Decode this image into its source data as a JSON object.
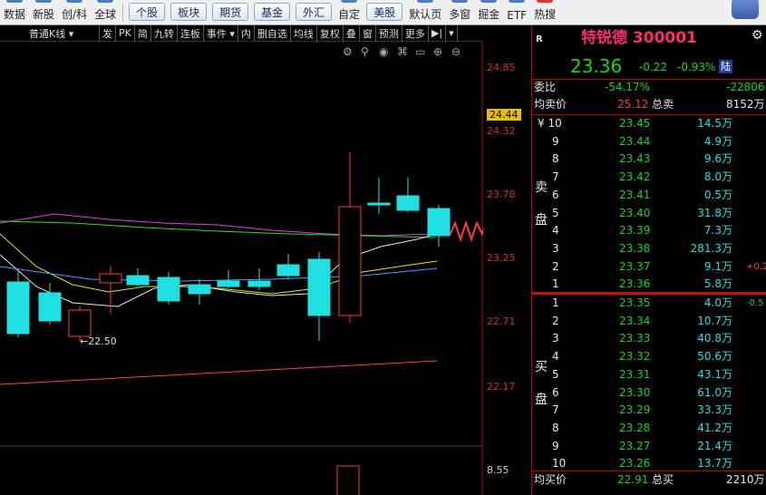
{
  "toolbar": {
    "items_left": [
      "数据",
      "新股",
      "创/科",
      "全球"
    ],
    "buttons": [
      "个股",
      "板块",
      "期货",
      "基金",
      "外汇"
    ],
    "items_mid": [
      "自定"
    ],
    "button2": "美股",
    "items_right": [
      "默认页",
      "多窗",
      "掘金",
      "ETF",
      "热搜"
    ]
  },
  "chart_tools": [
    "普通K线 ▾",
    "发",
    "PK",
    "简",
    "九转",
    "连板",
    "事件 ▾",
    "内",
    "删自选",
    "均线",
    "复权",
    "叠",
    "窗",
    "预测",
    "更多",
    "▶|",
    "▾"
  ],
  "price_axis": [
    "24.85",
    "24.44",
    "24.32",
    "23.78",
    "23.25",
    "22.71",
    "22.17",
    "8.55"
  ],
  "low_label": "22.50",
  "quote": {
    "badge": "R",
    "name_code": "特锐德 300001",
    "price": "23.36",
    "change": "-0.22",
    "change_pct": "-0.93%",
    "tag": "陆",
    "weibi_label": "委比",
    "weibi_value": "-54.17%",
    "weicha_value": "-22806",
    "avg_sell_label": "均卖价",
    "avg_sell_value": "25.12",
    "total_sell_label": "总卖",
    "total_sell_value": "8152万",
    "sell_side_label_1": "卖",
    "sell_side_label_2": "盘",
    "buy_side_label_1": "买",
    "buy_side_label_2": "盘",
    "sell_levels": [
      {
        "lv": "¥ 10",
        "price": "23.45",
        "vol": "14.5万"
      },
      {
        "lv": "9",
        "price": "23.44",
        "vol": "4.9万"
      },
      {
        "lv": "8",
        "price": "23.43",
        "vol": "9.6万"
      },
      {
        "lv": "7",
        "price": "23.42",
        "vol": "8.0万"
      },
      {
        "lv": "6",
        "price": "23.41",
        "vol": "0.5万"
      },
      {
        "lv": "5",
        "price": "23.40",
        "vol": "31.8万"
      },
      {
        "lv": "4",
        "price": "23.39",
        "vol": "7.3万"
      },
      {
        "lv": "3",
        "price": "23.38",
        "vol": "281.3万"
      },
      {
        "lv": "2",
        "price": "23.37",
        "vol": "9.1万",
        "extra": "+0.2"
      },
      {
        "lv": "1",
        "price": "23.36",
        "vol": "5.8万"
      }
    ],
    "buy_levels": [
      {
        "lv": "1",
        "price": "23.35",
        "vol": "4.0万",
        "extra": "-0.5"
      },
      {
        "lv": "2",
        "price": "23.34",
        "vol": "10.7万"
      },
      {
        "lv": "3",
        "price": "23.33",
        "vol": "40.8万"
      },
      {
        "lv": "4",
        "price": "23.32",
        "vol": "50.6万"
      },
      {
        "lv": "5",
        "price": "23.31",
        "vol": "43.1万"
      },
      {
        "lv": "6",
        "price": "23.30",
        "vol": "61.0万"
      },
      {
        "lv": "7",
        "price": "23.29",
        "vol": "33.3万"
      },
      {
        "lv": "8",
        "price": "23.28",
        "vol": "41.2万"
      },
      {
        "lv": "9",
        "price": "23.27",
        "vol": "21.4万"
      },
      {
        "lv": "10",
        "price": "23.26",
        "vol": "13.7万"
      }
    ],
    "avg_buy_label": "均买价",
    "avg_buy_value": "22.91",
    "total_buy_label": "总买",
    "total_buy_value": "2210万"
  },
  "colors": {
    "up": "#ff3c3c",
    "down": "#1ee0e0",
    "ma5": "#e8e8e8",
    "ma10": "#e6e600",
    "ma20": "#e040e0",
    "ma30": "#20e020",
    "ma60": "#ff3c3c"
  }
}
